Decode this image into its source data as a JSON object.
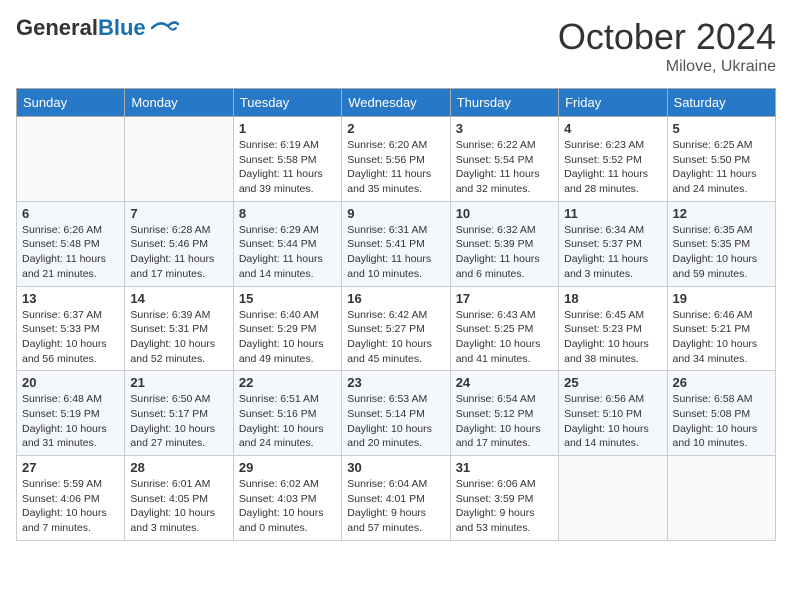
{
  "logo": {
    "general": "General",
    "blue": "Blue"
  },
  "header": {
    "month": "October 2024",
    "location": "Milove, Ukraine"
  },
  "weekdays": [
    "Sunday",
    "Monday",
    "Tuesday",
    "Wednesday",
    "Thursday",
    "Friday",
    "Saturday"
  ],
  "weeks": [
    [
      {
        "day": "",
        "info": ""
      },
      {
        "day": "",
        "info": ""
      },
      {
        "day": "1",
        "info": "Sunrise: 6:19 AM\nSunset: 5:58 PM\nDaylight: 11 hours\nand 39 minutes."
      },
      {
        "day": "2",
        "info": "Sunrise: 6:20 AM\nSunset: 5:56 PM\nDaylight: 11 hours\nand 35 minutes."
      },
      {
        "day": "3",
        "info": "Sunrise: 6:22 AM\nSunset: 5:54 PM\nDaylight: 11 hours\nand 32 minutes."
      },
      {
        "day": "4",
        "info": "Sunrise: 6:23 AM\nSunset: 5:52 PM\nDaylight: 11 hours\nand 28 minutes."
      },
      {
        "day": "5",
        "info": "Sunrise: 6:25 AM\nSunset: 5:50 PM\nDaylight: 11 hours\nand 24 minutes."
      }
    ],
    [
      {
        "day": "6",
        "info": "Sunrise: 6:26 AM\nSunset: 5:48 PM\nDaylight: 11 hours\nand 21 minutes."
      },
      {
        "day": "7",
        "info": "Sunrise: 6:28 AM\nSunset: 5:46 PM\nDaylight: 11 hours\nand 17 minutes."
      },
      {
        "day": "8",
        "info": "Sunrise: 6:29 AM\nSunset: 5:44 PM\nDaylight: 11 hours\nand 14 minutes."
      },
      {
        "day": "9",
        "info": "Sunrise: 6:31 AM\nSunset: 5:41 PM\nDaylight: 11 hours\nand 10 minutes."
      },
      {
        "day": "10",
        "info": "Sunrise: 6:32 AM\nSunset: 5:39 PM\nDaylight: 11 hours\nand 6 minutes."
      },
      {
        "day": "11",
        "info": "Sunrise: 6:34 AM\nSunset: 5:37 PM\nDaylight: 11 hours\nand 3 minutes."
      },
      {
        "day": "12",
        "info": "Sunrise: 6:35 AM\nSunset: 5:35 PM\nDaylight: 10 hours\nand 59 minutes."
      }
    ],
    [
      {
        "day": "13",
        "info": "Sunrise: 6:37 AM\nSunset: 5:33 PM\nDaylight: 10 hours\nand 56 minutes."
      },
      {
        "day": "14",
        "info": "Sunrise: 6:39 AM\nSunset: 5:31 PM\nDaylight: 10 hours\nand 52 minutes."
      },
      {
        "day": "15",
        "info": "Sunrise: 6:40 AM\nSunset: 5:29 PM\nDaylight: 10 hours\nand 49 minutes."
      },
      {
        "day": "16",
        "info": "Sunrise: 6:42 AM\nSunset: 5:27 PM\nDaylight: 10 hours\nand 45 minutes."
      },
      {
        "day": "17",
        "info": "Sunrise: 6:43 AM\nSunset: 5:25 PM\nDaylight: 10 hours\nand 41 minutes."
      },
      {
        "day": "18",
        "info": "Sunrise: 6:45 AM\nSunset: 5:23 PM\nDaylight: 10 hours\nand 38 minutes."
      },
      {
        "day": "19",
        "info": "Sunrise: 6:46 AM\nSunset: 5:21 PM\nDaylight: 10 hours\nand 34 minutes."
      }
    ],
    [
      {
        "day": "20",
        "info": "Sunrise: 6:48 AM\nSunset: 5:19 PM\nDaylight: 10 hours\nand 31 minutes."
      },
      {
        "day": "21",
        "info": "Sunrise: 6:50 AM\nSunset: 5:17 PM\nDaylight: 10 hours\nand 27 minutes."
      },
      {
        "day": "22",
        "info": "Sunrise: 6:51 AM\nSunset: 5:16 PM\nDaylight: 10 hours\nand 24 minutes."
      },
      {
        "day": "23",
        "info": "Sunrise: 6:53 AM\nSunset: 5:14 PM\nDaylight: 10 hours\nand 20 minutes."
      },
      {
        "day": "24",
        "info": "Sunrise: 6:54 AM\nSunset: 5:12 PM\nDaylight: 10 hours\nand 17 minutes."
      },
      {
        "day": "25",
        "info": "Sunrise: 6:56 AM\nSunset: 5:10 PM\nDaylight: 10 hours\nand 14 minutes."
      },
      {
        "day": "26",
        "info": "Sunrise: 6:58 AM\nSunset: 5:08 PM\nDaylight: 10 hours\nand 10 minutes."
      }
    ],
    [
      {
        "day": "27",
        "info": "Sunrise: 5:59 AM\nSunset: 4:06 PM\nDaylight: 10 hours\nand 7 minutes."
      },
      {
        "day": "28",
        "info": "Sunrise: 6:01 AM\nSunset: 4:05 PM\nDaylight: 10 hours\nand 3 minutes."
      },
      {
        "day": "29",
        "info": "Sunrise: 6:02 AM\nSunset: 4:03 PM\nDaylight: 10 hours\nand 0 minutes."
      },
      {
        "day": "30",
        "info": "Sunrise: 6:04 AM\nSunset: 4:01 PM\nDaylight: 9 hours\nand 57 minutes."
      },
      {
        "day": "31",
        "info": "Sunrise: 6:06 AM\nSunset: 3:59 PM\nDaylight: 9 hours\nand 53 minutes."
      },
      {
        "day": "",
        "info": ""
      },
      {
        "day": "",
        "info": ""
      }
    ]
  ]
}
